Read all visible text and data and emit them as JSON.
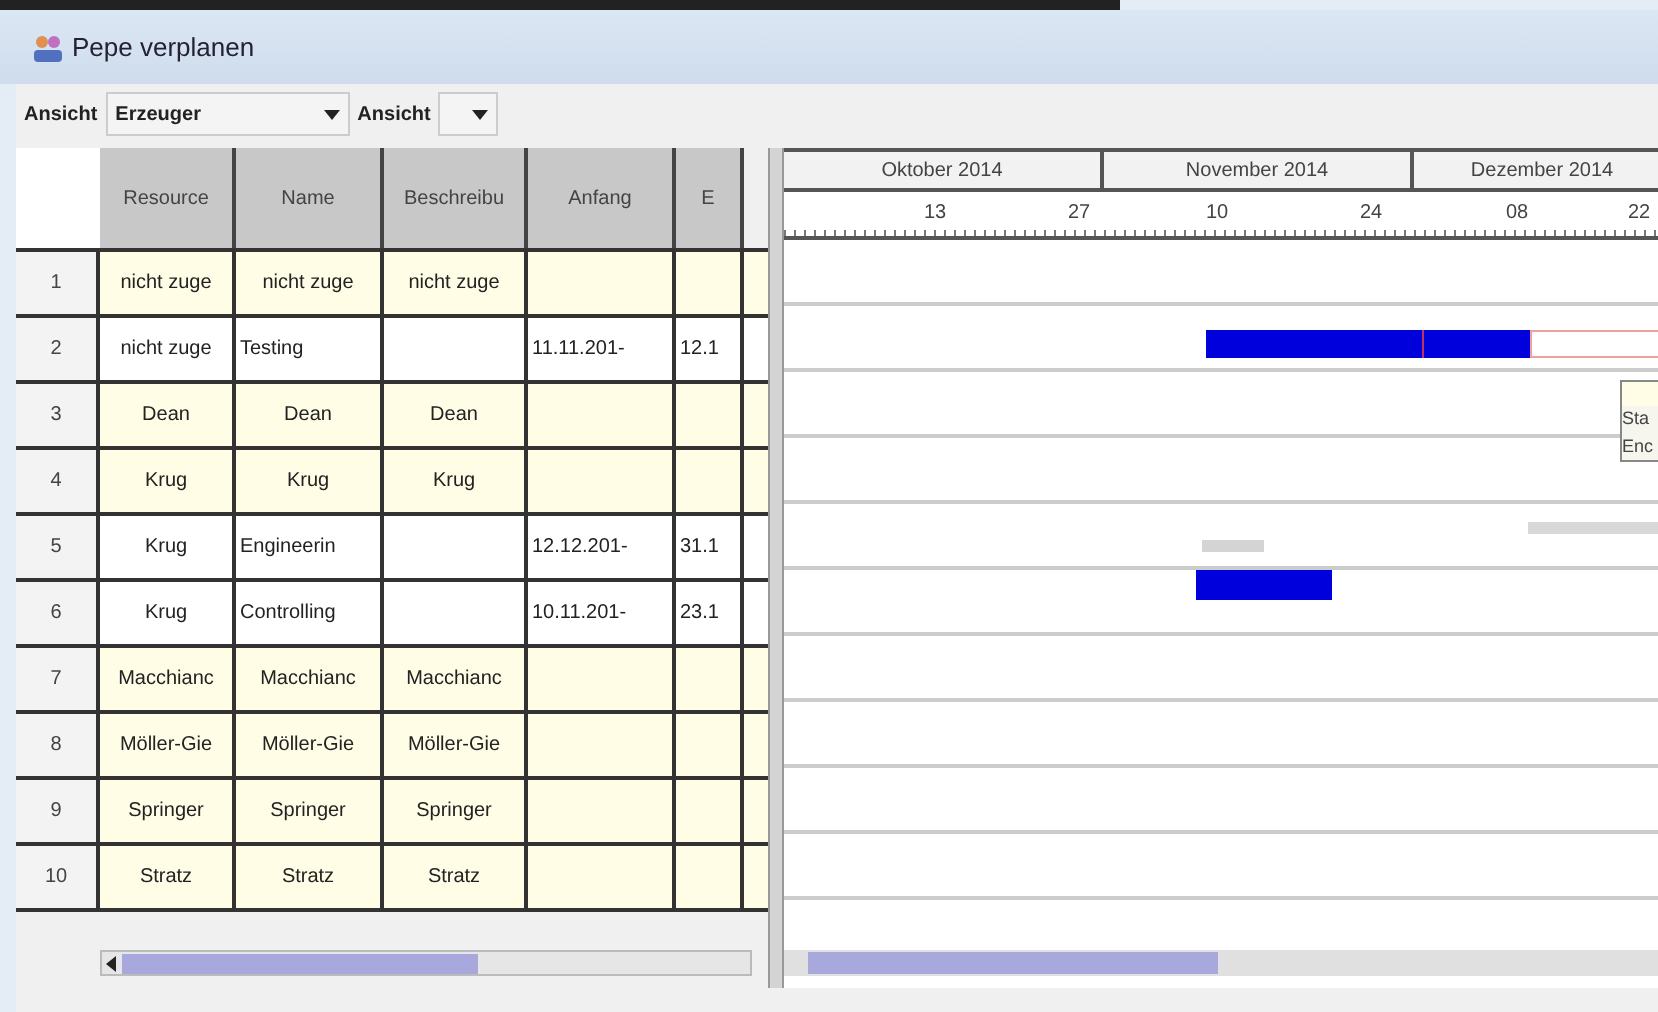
{
  "window": {
    "title": "Pepe verplanen"
  },
  "toolbar": [
    {
      "label": "Ansicht",
      "value": "Erzeuger"
    },
    {
      "label": "Ansicht"
    }
  ],
  "table": {
    "columns": [
      "Resource",
      "Name",
      "Beschreibu",
      "Anfang",
      "E"
    ],
    "rows": [
      {
        "number": "1",
        "kind": "resource",
        "cells": [
          "nicht zuge",
          "nicht zuge",
          "nicht zuge",
          "",
          ""
        ]
      },
      {
        "number": "2",
        "kind": "task",
        "cells": [
          "nicht zuge",
          "Testing",
          "",
          "11.11.201-",
          "12.1"
        ]
      },
      {
        "number": "3",
        "kind": "resource",
        "cells": [
          "Dean",
          "Dean",
          "Dean",
          "",
          ""
        ]
      },
      {
        "number": "4",
        "kind": "resource",
        "cells": [
          "Krug",
          "Krug",
          "Krug",
          "",
          ""
        ]
      },
      {
        "number": "5",
        "kind": "task",
        "cells": [
          "Krug",
          "Engineerin",
          "",
          "12.12.201-",
          "31.1"
        ]
      },
      {
        "number": "6",
        "kind": "task",
        "cells": [
          "Krug",
          "Controlling",
          "",
          "10.11.201-",
          "23.1"
        ]
      },
      {
        "number": "7",
        "kind": "resource",
        "cells": [
          "Macchianc",
          "Macchianc",
          "Macchianc",
          "",
          ""
        ]
      },
      {
        "number": "8",
        "kind": "resource",
        "cells": [
          "Möller-Gie",
          "Möller-Gie",
          "Möller-Gie",
          "",
          ""
        ]
      },
      {
        "number": "9",
        "kind": "resource",
        "cells": [
          "Springer",
          "Springer",
          "Springer",
          "",
          ""
        ]
      },
      {
        "number": "10",
        "kind": "resource",
        "cells": [
          "Stratz",
          "Stratz",
          "Stratz",
          "",
          ""
        ]
      }
    ]
  },
  "gantt": {
    "months": [
      "Oktober 2014",
      "November 2014",
      "Dezember 2014"
    ],
    "weeks": [
      "13",
      "27",
      "10",
      "24",
      "08",
      "22"
    ],
    "tooltip": [
      "Sta",
      "Enc"
    ]
  }
}
